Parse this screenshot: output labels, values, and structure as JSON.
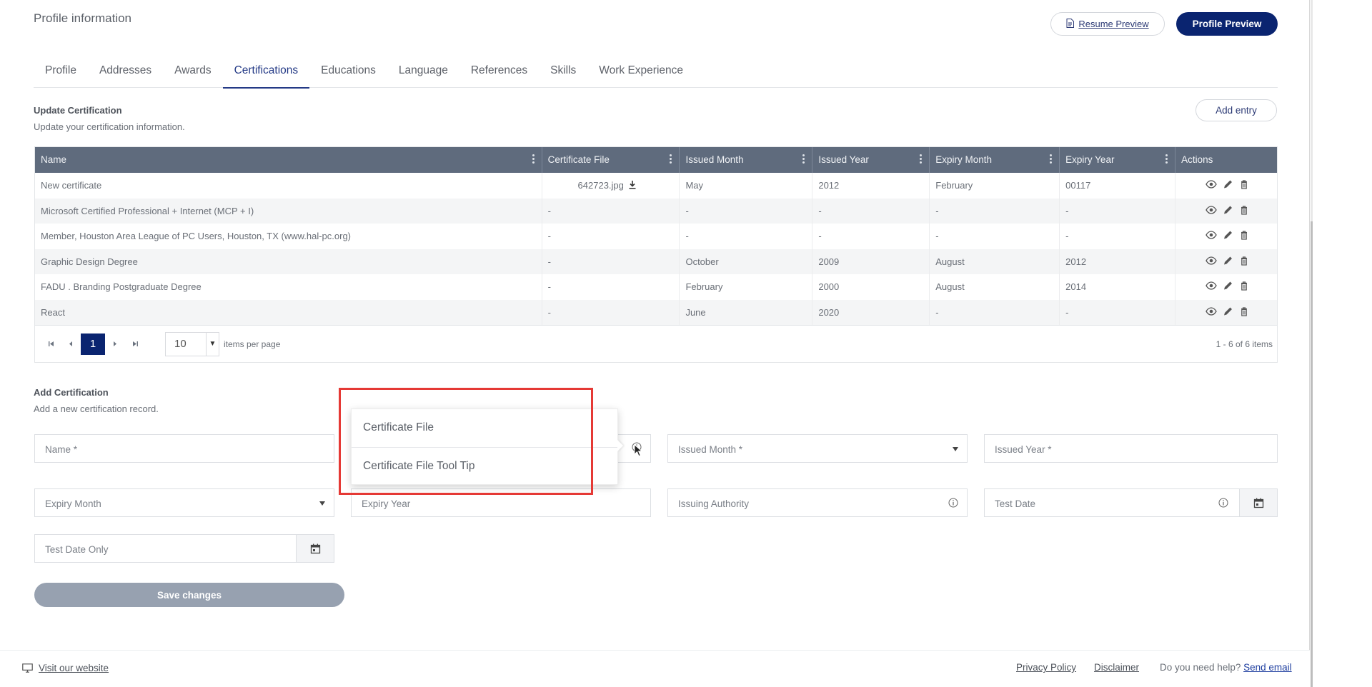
{
  "header": {
    "title": "Profile information",
    "resume_preview": "Resume Preview",
    "profile_preview": "Profile Preview"
  },
  "tabs": [
    {
      "label": "Profile"
    },
    {
      "label": "Addresses"
    },
    {
      "label": "Awards"
    },
    {
      "label": "Certifications"
    },
    {
      "label": "Educations"
    },
    {
      "label": "Language"
    },
    {
      "label": "References"
    },
    {
      "label": "Skills"
    },
    {
      "label": "Work Experience"
    }
  ],
  "active_tab": "Certifications",
  "update_section": {
    "title": "Update Certification",
    "subtitle": "Update your certification information.",
    "add_entry": "Add entry"
  },
  "grid": {
    "columns": [
      "Name",
      "Certificate File",
      "Issued Month",
      "Issued Year",
      "Expiry Month",
      "Expiry Year",
      "Actions"
    ],
    "rows": [
      {
        "name": "New certificate",
        "file": "642723.jpg",
        "issued_month": "May",
        "issued_year": "2012",
        "expiry_month": "February",
        "expiry_year": "00117"
      },
      {
        "name": "Microsoft Certified Professional + Internet (MCP + I)",
        "file": "-",
        "issued_month": "-",
        "issued_year": "-",
        "expiry_month": "-",
        "expiry_year": "-"
      },
      {
        "name": "Member, Houston Area League of PC Users, Houston, TX (www.hal-pc.org)",
        "file": "-",
        "issued_month": "-",
        "issued_year": "-",
        "expiry_month": "-",
        "expiry_year": "-"
      },
      {
        "name": "Graphic Design Degree",
        "file": "-",
        "issued_month": "October",
        "issued_year": "2009",
        "expiry_month": "August",
        "expiry_year": "2012"
      },
      {
        "name": "FADU . Branding Postgraduate Degree",
        "file": "-",
        "issued_month": "February",
        "issued_year": "2000",
        "expiry_month": "August",
        "expiry_year": "2014"
      },
      {
        "name": "React",
        "file": "-",
        "issued_month": "June",
        "issued_year": "2020",
        "expiry_month": "-",
        "expiry_year": "-"
      }
    ],
    "pager": {
      "current_page": "1",
      "page_size": "10",
      "page_size_label": "items per page",
      "info": "1 - 6 of 6 items"
    }
  },
  "add_section": {
    "title": "Add Certification",
    "subtitle": "Add a new certification record."
  },
  "form": {
    "name": "Name *",
    "issued_month": "Issued Month *",
    "issued_year": "Issued Year *",
    "expiry_month": "Expiry Month",
    "expiry_year": "Expiry Year",
    "issuing_authority": "Issuing Authority",
    "test_date": "Test Date",
    "test_date_only": "Test Date Only",
    "save": "Save changes"
  },
  "tooltip_popup": {
    "items": [
      "Certificate File",
      "Certificate File Tool Tip"
    ]
  },
  "footer": {
    "visit": "Visit our website",
    "privacy": "Privacy Policy",
    "disclaimer": "Disclaimer",
    "help_text": "Do you need help?",
    "send_email": "Send email"
  },
  "colors": {
    "primary": "#0a2470",
    "grid_header": "#5f6b7d",
    "highlight": "#e53935",
    "disabled_button": "#97a1b0"
  }
}
